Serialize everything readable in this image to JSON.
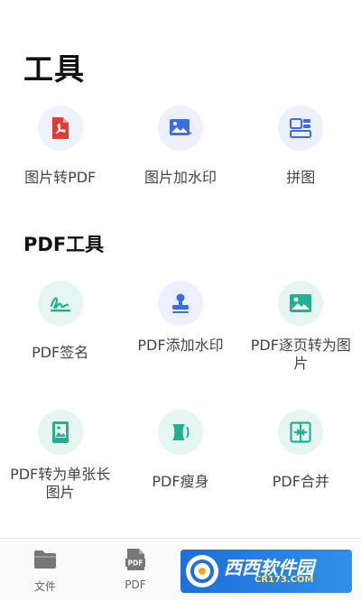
{
  "page": {
    "title": "工具"
  },
  "tools": [
    {
      "label": "图片转PDF",
      "icon": "pdf-file-icon"
    },
    {
      "label": "图片加水印",
      "icon": "image-watermark-icon"
    },
    {
      "label": "拼图",
      "icon": "collage-icon"
    }
  ],
  "pdf_section": {
    "title": "PDF工具"
  },
  "pdf_tools": [
    {
      "label": "PDF签名",
      "icon": "signature-icon"
    },
    {
      "label": "PDF添加水印",
      "icon": "stamp-icon"
    },
    {
      "label": "PDF逐页转为图片",
      "icon": "image-icon"
    },
    {
      "label": "PDF转为单张长图片",
      "icon": "long-image-icon"
    },
    {
      "label": "PDF瘦身",
      "icon": "compress-icon"
    },
    {
      "label": "PDF合并",
      "icon": "merge-icon"
    }
  ],
  "tabbar": [
    {
      "label": "文件",
      "icon": "folder-icon"
    },
    {
      "label": "PDF",
      "icon": "pdf-doc-icon"
    },
    {
      "label": "",
      "icon": "toolbox-icon"
    },
    {
      "label": "",
      "icon": "profile-icon"
    }
  ],
  "watermark": {
    "text": "西西软件园",
    "sub": "CR173.COM"
  },
  "colors": {
    "accent_blue": "#3b6fe0",
    "accent_teal": "#23b08f",
    "pdf_red": "#e53935"
  }
}
